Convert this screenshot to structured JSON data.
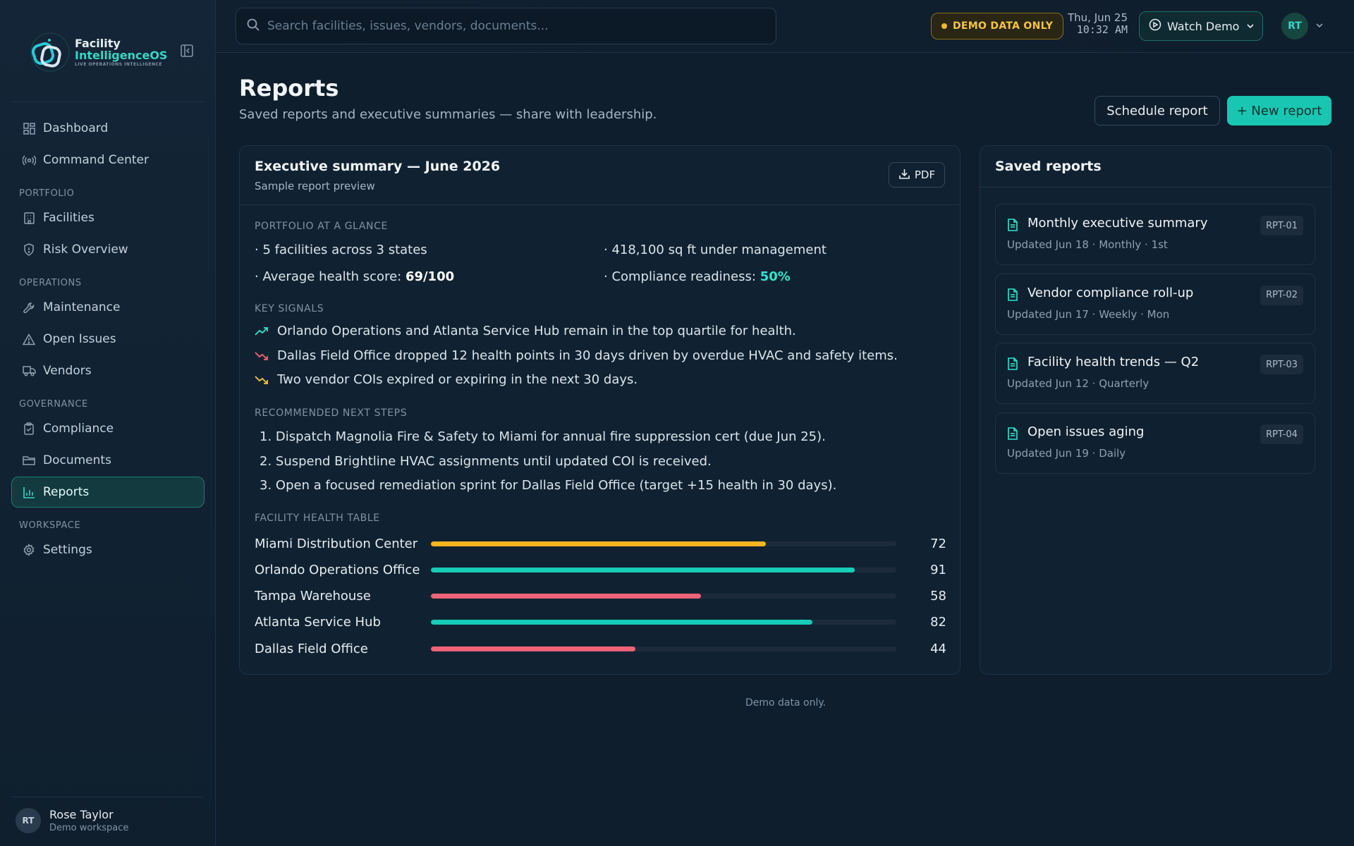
{
  "brand": {
    "line1": "Facility",
    "line2": "IntelligenceOS",
    "tagline": "LIVE OPERATIONS INTELLIGENCE"
  },
  "sidebar": {
    "top_items": [
      {
        "label": "Dashboard",
        "icon": "grid-icon"
      },
      {
        "label": "Command Center",
        "icon": "broadcast-icon"
      }
    ],
    "sections": [
      {
        "title": "PORTFOLIO",
        "items": [
          {
            "label": "Facilities",
            "icon": "building-icon"
          },
          {
            "label": "Risk Overview",
            "icon": "shield-icon"
          }
        ]
      },
      {
        "title": "OPERATIONS",
        "items": [
          {
            "label": "Maintenance",
            "icon": "wrench-icon"
          },
          {
            "label": "Open Issues",
            "icon": "warning-icon"
          },
          {
            "label": "Vendors",
            "icon": "truck-icon"
          }
        ]
      },
      {
        "title": "GOVERNANCE",
        "items": [
          {
            "label": "Compliance",
            "icon": "clipboard-icon"
          },
          {
            "label": "Documents",
            "icon": "folder-icon"
          },
          {
            "label": "Reports",
            "icon": "bar-chart-icon",
            "active": true
          }
        ]
      },
      {
        "title": "WORKSPACE",
        "items": [
          {
            "label": "Settings",
            "icon": "gear-icon"
          }
        ]
      }
    ],
    "user": {
      "initials": "RT",
      "name": "Rose Taylor",
      "workspace": "Demo workspace"
    }
  },
  "topbar": {
    "search_placeholder": "Search facilities, issues, vendors, documents...",
    "demo_badge": "DEMO DATA ONLY",
    "date": "Thu, Jun 25",
    "time": "10:32 AM",
    "watch_demo": "Watch Demo",
    "avatar_initials": "RT"
  },
  "page": {
    "title": "Reports",
    "subtitle": "Saved reports and executive summaries — share with leadership.",
    "schedule_btn": "Schedule report",
    "new_btn": "+ New report"
  },
  "report": {
    "title": "Executive summary — June 2026",
    "subtitle": "Sample report preview",
    "pdf_btn": "PDF",
    "glance_label": "PORTFOLIO AT A GLANCE",
    "glance": {
      "facilities": "· 5 facilities across 3 states",
      "sqft": "· 418,100 sq ft under management",
      "health_prefix": "· Average health score: ",
      "health_value": "69/100",
      "compliance_prefix": "· Compliance readiness: ",
      "compliance_value": "50%"
    },
    "signals_label": "KEY SIGNALS",
    "signals": [
      {
        "text": "Orlando Operations and Atlanta Service Hub remain in the top quartile for health.",
        "icon": "trend-up-icon",
        "color": "#2ee6cf"
      },
      {
        "text": "Dallas Field Office dropped 12 health points in 30 days driven by overdue HVAC and safety items.",
        "icon": "trend-down-icon",
        "color": "#f06277"
      },
      {
        "text": "Two vendor COIs expired or expiring in the next 30 days.",
        "icon": "trend-down-icon",
        "color": "#f3c444"
      }
    ],
    "steps_label": "RECOMMENDED NEXT STEPS",
    "steps": [
      "1. Dispatch Magnolia Fire & Safety to Miami for annual fire suppression cert (due Jun 25).",
      "2. Suspend Brightline HVAC assignments until updated COI is received.",
      "3. Open a focused remediation sprint for Dallas Field Office (target +15 health in 30 days)."
    ],
    "table_label": "FACILITY HEALTH TABLE",
    "health_table": [
      {
        "name": "Miami Distribution Center",
        "score": 72,
        "color": "#f6b71e"
      },
      {
        "name": "Orlando Operations Office",
        "score": 91,
        "color": "#17cdb7"
      },
      {
        "name": "Tampa Warehouse",
        "score": 58,
        "color": "#f06277"
      },
      {
        "name": "Atlanta Service Hub",
        "score": 82,
        "color": "#17cdb7"
      },
      {
        "name": "Dallas Field Office",
        "score": 44,
        "color": "#f06277"
      }
    ]
  },
  "saved": {
    "title": "Saved reports",
    "items": [
      {
        "title": "Monthly executive summary",
        "meta": "Updated Jun 18 · Monthly · 1st",
        "code": "RPT-01"
      },
      {
        "title": "Vendor compliance roll-up",
        "meta": "Updated Jun 17 · Weekly · Mon",
        "code": "RPT-02"
      },
      {
        "title": "Facility health trends — Q2",
        "meta": "Updated Jun 12 · Quarterly",
        "code": "RPT-03"
      },
      {
        "title": "Open issues aging",
        "meta": "Updated Jun 19 · Daily",
        "code": "RPT-04"
      }
    ]
  },
  "footer_note": "Demo data only.",
  "colors": {
    "accent": "#19c6b1",
    "warning": "#f3c444",
    "danger": "#f06277"
  }
}
